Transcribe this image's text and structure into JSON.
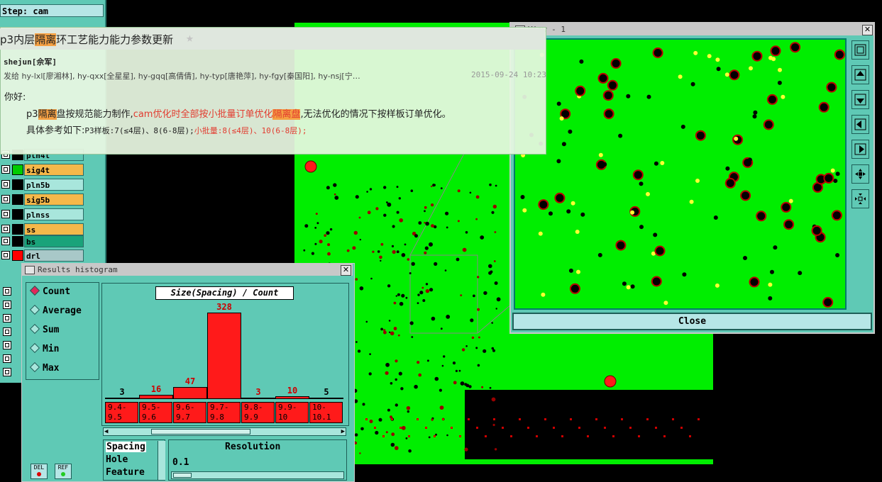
{
  "left_panel": {
    "step_label": "Step: cam",
    "layers": [
      {
        "name": "pln4t",
        "color": "#000000",
        "bg": "#5fc9b5"
      },
      {
        "name": "sig4t",
        "color": "#00cc00",
        "bg": "#f5b84a"
      },
      {
        "name": "pln5b",
        "color": "#000000",
        "bg": "#a8e6dc"
      },
      {
        "name": "sig5b",
        "color": "#000000",
        "bg": "#f5b84a"
      },
      {
        "name": "plnss",
        "color": "#000000",
        "bg": "#a8e6dc"
      },
      {
        "name": "ss",
        "color": "#000000",
        "bg": "#f5b84a"
      },
      {
        "name": "bs",
        "color": "#000000",
        "bg": "#1aa37a"
      },
      {
        "name": "drl",
        "color": "#ff0000",
        "bg": "#a8c8c8"
      }
    ]
  },
  "note": {
    "title_prefix": "p3内层",
    "title_highlight": "隔离",
    "title_suffix": "环工艺能力能力参数更新",
    "author": "shejun[佘军]",
    "recipients": "发给 hy-lxl[廖湘林], hy-qxx[全星星], hy-gqq[高倩倩], hy-typ[唐艳萍], hy-fgy[秦国阳], hy-nsj[宁…",
    "date": "2015-09-24 10:23",
    "greeting": "你好:",
    "line1_a": "p3",
    "line1_hl": "隔离",
    "line1_b": "盘按规范能力制作,",
    "line1_red_a": "cam优化时全部按小批量订单优化",
    "line1_red_hl": "隔离盘",
    "line1_c": ",无法优化的情况下按样板订单优化。",
    "line2_a": "具体参考如下:",
    "line2_b": "P3样板:7(≤4层)、8(6-8层);",
    "line2_red": "小批量:8(≤4层)、10(6-8层);"
  },
  "view_window": {
    "title": "View - 1",
    "close_label": "Close"
  },
  "histogram": {
    "title": "Results histogram",
    "radio_options": [
      "Count",
      "Average",
      "Sum",
      "Min",
      "Max"
    ],
    "selected": "Count",
    "list_items": [
      "Spacing",
      "Hole",
      "Feature"
    ],
    "resolution_label": "Resolution",
    "resolution_value": "0.1",
    "del_label": "DEL",
    "ref_label": "REF",
    "chart_data": {
      "type": "bar",
      "title": "Size(Spacing) / Count",
      "categories": [
        "9.4-9.5",
        "9.5-9.6",
        "9.6-9.7",
        "9.7-9.8",
        "9.8-9.9",
        "9.9-10",
        "10-10.1"
      ],
      "category_lines": [
        [
          "9.4-",
          "9.5"
        ],
        [
          "9.5-",
          "9.6"
        ],
        [
          "9.6-",
          "9.7"
        ],
        [
          "9.7-",
          "9.8"
        ],
        [
          "9.8-",
          "9.9"
        ],
        [
          "9.9-",
          "10"
        ],
        [
          "10-",
          "10.1"
        ]
      ],
      "values": [
        3,
        16,
        47,
        328,
        3,
        10,
        5
      ],
      "value_label_colors": [
        "#000000",
        "#cc0000",
        "#cc0000",
        "#cc0000",
        "#cc0000",
        "#cc0000",
        "#000000"
      ]
    }
  },
  "colors": {
    "board_green": "#00ee00",
    "pad_red": "#cc0000",
    "panel_teal": "#5fc9b5"
  }
}
